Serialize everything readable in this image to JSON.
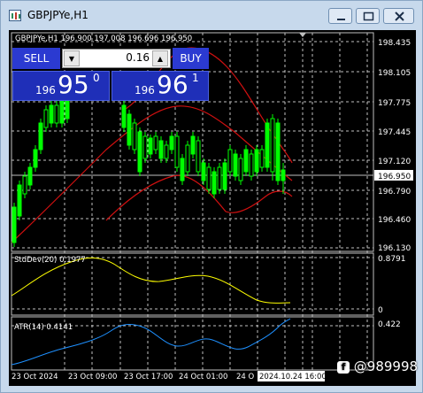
{
  "window": {
    "title": "GBPJPYe,H1",
    "icon": "chart-window-icon",
    "buttons": [
      "minimize",
      "maximize",
      "close"
    ]
  },
  "chart": {
    "info_line": "GBPJPYe,H1  196.900 197.008 196.696 196.950",
    "price_axis": [
      "198.435",
      "198.105",
      "197.775",
      "197.445",
      "197.120",
      "196.950",
      "196.790",
      "196.460",
      "196.130"
    ],
    "current_price": "196.950",
    "time_axis": [
      "23 Oct 2024",
      "23 Oct 09:00",
      "23 Oct 17:00",
      "24 Oct 01:00",
      "24 O"
    ],
    "crosshair_time": "2024.10.24 16:00",
    "colors": {
      "bull_candle": "#00ff00",
      "bear_candle": "#000000",
      "bands": "#ff0000",
      "stddev": "#ffff00",
      "atr": "#1e90ff",
      "grid": "#c0c0c0"
    }
  },
  "trading_panel": {
    "sell_label": "SELL",
    "buy_label": "BUY",
    "lot": "0.16",
    "sell_price": {
      "big_figure": "196",
      "pips": "95",
      "point": "0"
    },
    "buy_price": {
      "big_figure": "196",
      "pips": "96",
      "point": "1"
    }
  },
  "indicators": [
    {
      "label": "StdDev(20) 0.1977",
      "scale_top": "0.8791",
      "scale_bottom": "0"
    },
    {
      "label": "ATR(14) 0.4141",
      "scale_top": "0.422"
    }
  ],
  "watermark": "@989998"
}
